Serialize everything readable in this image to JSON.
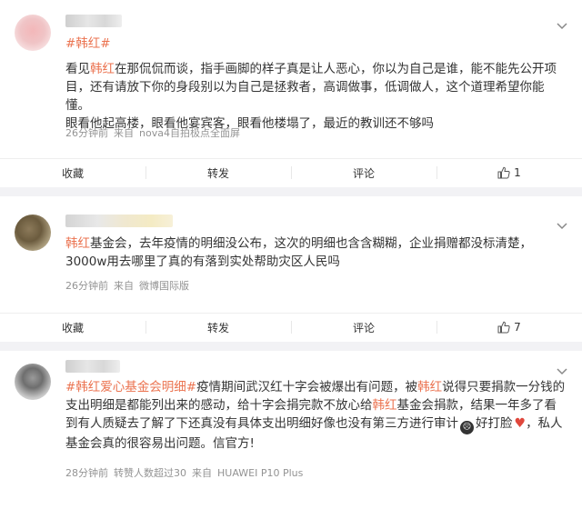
{
  "posts": [
    {
      "hashtag": "#韩红#",
      "body": {
        "p1_a": "看见",
        "p1_link": "韩红",
        "p1_b": "在那侃侃而谈，指手画脚的样子真是让人恶心，你以为自己是谁，能不能先公开项目，还有请放下你的身段别以为自己是拯救者，高调做事，低调做人，这个道理希望你能懂。",
        "p2": "眼看他起高楼，眼看他宴宾客，眼看他楼塌了，最近的教训还不够吗"
      },
      "meta": {
        "time": "26分钟前",
        "from_prefix": "来自",
        "source": "nova4自拍极点全面屏"
      },
      "actions": {
        "collect": "收藏",
        "repost": "转发",
        "comment": "评论",
        "like_count": "1"
      }
    },
    {
      "body": {
        "link": "韩红",
        "text": "基金会，去年疫情的明细没公布，这次的明细也含含糊糊，企业捐赠都没标清楚，3000w用去哪里了真的有落到实处帮助灾区人民吗"
      },
      "meta": {
        "time": "26分钟前",
        "from_prefix": "来自",
        "source": "微博国际版"
      },
      "actions": {
        "collect": "收藏",
        "repost": "转发",
        "comment": "评论",
        "like_count": "7"
      }
    },
    {
      "hashtag": "#韩红爱心基金会明细#",
      "body": {
        "t1": "疫情期间武汉红十字会被爆出有问题，被",
        "link1": "韩红",
        "t2": "说得只要捐款一分钱的支出明细是都能列出来的感动，给十字会捐完款不放心给",
        "link2": "韩红",
        "t3": "基金会捐款，结果一年多了看到有人质疑去了解了下还真没有具体支出明细好像也没有第三方进行审计",
        "emoji1_label": "好打脸",
        "t4": "，私人基金会真的很容易出问题。信官方!"
      },
      "meta": {
        "time": "28分钟前",
        "reposts": "转赞人数超过30",
        "from_prefix": "来自",
        "source": "HUAWEI P10 Plus"
      }
    }
  ],
  "icons": {
    "chevron": "chevron-down-icon",
    "like": "thumbs-up-icon",
    "emoji_cry": "crying-face-icon",
    "emoji_heart": "broken-heart-icon"
  },
  "colors": {
    "link": "#eb7350",
    "meta": "#939393",
    "separator": "#f2f2f5"
  }
}
